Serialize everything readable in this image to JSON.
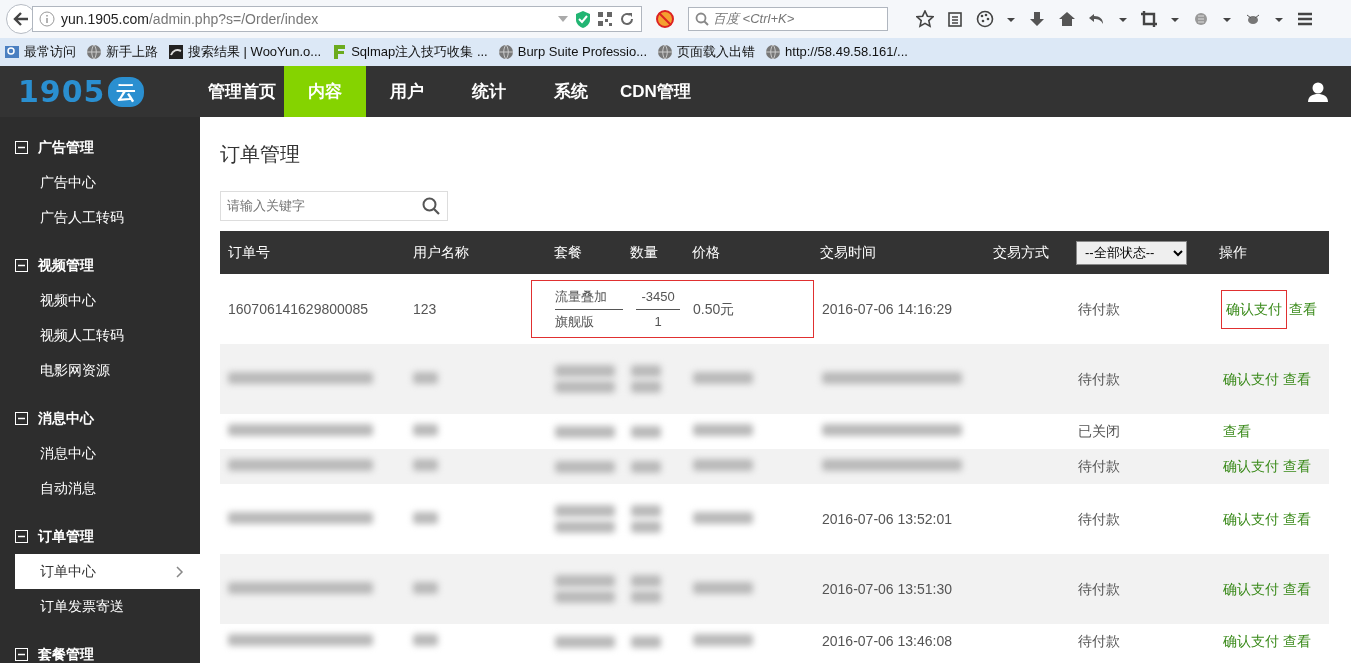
{
  "browser": {
    "url_host": "yun.1905.com",
    "url_path": "/admin.php?s=/Order/index",
    "search_placeholder": "百度 <Ctrl+K>",
    "bookmarks": [
      {
        "label": "最常访问",
        "kind": "folder"
      },
      {
        "label": "新手上路",
        "kind": "globe"
      },
      {
        "label": "搜索结果 | WooYun.o...",
        "kind": "site"
      },
      {
        "label": "Sqlmap注入技巧收集 ...",
        "kind": "leaf"
      },
      {
        "label": "Burp Suite Professio...",
        "kind": "globe"
      },
      {
        "label": "页面载入出错",
        "kind": "globe"
      },
      {
        "label": "http://58.49.58.161/...",
        "kind": "globe"
      }
    ]
  },
  "app": {
    "logo": "1905",
    "logo_suffix": "云",
    "nav": [
      {
        "label": "管理首页",
        "selected": false
      },
      {
        "label": "内容",
        "selected": true
      },
      {
        "label": "用户",
        "selected": false
      },
      {
        "label": "统计",
        "selected": false
      },
      {
        "label": "系统",
        "selected": false
      },
      {
        "label": "CDN管理",
        "selected": false
      }
    ]
  },
  "sidebar": {
    "items": [
      {
        "label": "广告管理",
        "expanded": true,
        "children": [
          {
            "label": "广告中心",
            "selected": false
          },
          {
            "label": "广告人工转码",
            "selected": false
          }
        ]
      },
      {
        "label": "视频管理",
        "expanded": true,
        "children": [
          {
            "label": "视频中心",
            "selected": false
          },
          {
            "label": "视频人工转码",
            "selected": false
          },
          {
            "label": "电影网资源",
            "selected": false
          }
        ]
      },
      {
        "label": "消息中心",
        "expanded": true,
        "children": [
          {
            "label": "消息中心",
            "selected": false
          },
          {
            "label": "自动消息",
            "selected": false
          }
        ]
      },
      {
        "label": "订单管理",
        "expanded": true,
        "children": [
          {
            "label": "订单中心",
            "selected": true
          },
          {
            "label": "订单发票寄送",
            "selected": false
          }
        ]
      },
      {
        "label": "套餐管理",
        "expanded": true
      }
    ]
  },
  "page": {
    "title": "订单管理",
    "search": {
      "placeholder": "请输入关键字"
    },
    "table": {
      "columns": [
        "订单号",
        "用户名称",
        "套餐",
        "数量",
        "价格",
        "交易时间",
        "交易方式"
      ],
      "status_filter": "--全部状态--",
      "actions_column": "操作",
      "rows": [
        {
          "kind": "bundle",
          "order_id": "160706141629800085",
          "user": "123",
          "plans": [
            "流量叠加",
            "旗舰版"
          ],
          "quantities": [
            "-3450",
            "1"
          ],
          "price": "0.50元",
          "time": "2016-07-06 14:16:29",
          "status": "待付款",
          "highlighted": true,
          "actions": [
            {
              "label": "确认支付",
              "highlighted": true
            },
            {
              "label": "查看",
              "highlighted": false
            }
          ],
          "blurred": false
        },
        {
          "kind": "bundle",
          "status": "待付款",
          "highlighted": false,
          "actions": [
            {
              "label": "确认支付",
              "highlighted": false
            },
            {
              "label": "查看",
              "highlighted": false
            }
          ],
          "blurred": true
        },
        {
          "kind": "single",
          "status": "已关闭",
          "highlighted": false,
          "actions": [
            {
              "label": "查看",
              "highlighted": false
            }
          ],
          "blurred": true
        },
        {
          "kind": "single",
          "status": "待付款",
          "highlighted": false,
          "actions": [
            {
              "label": "确认支付",
              "highlighted": false
            },
            {
              "label": "查看",
              "highlighted": false
            }
          ],
          "blurred": true
        },
        {
          "kind": "bundle",
          "time": "2016-07-06 13:52:01",
          "status": "待付款",
          "highlighted": false,
          "actions": [
            {
              "label": "确认支付",
              "highlighted": false
            },
            {
              "label": "查看",
              "highlighted": false
            }
          ],
          "blurred": true
        },
        {
          "kind": "bundle",
          "time": "2016-07-06 13:51:30",
          "status": "待付款",
          "highlighted": false,
          "actions": [
            {
              "label": "确认支付",
              "highlighted": false
            },
            {
              "label": "查看",
              "highlighted": false
            }
          ],
          "blurred": true
        },
        {
          "kind": "single",
          "time": "2016-07-06 13:46:08",
          "status": "待付款",
          "highlighted": false,
          "actions": [
            {
              "label": "确认支付",
              "highlighted": false
            },
            {
              "label": "查看",
              "highlighted": false
            }
          ],
          "blurred": true
        }
      ]
    }
  }
}
